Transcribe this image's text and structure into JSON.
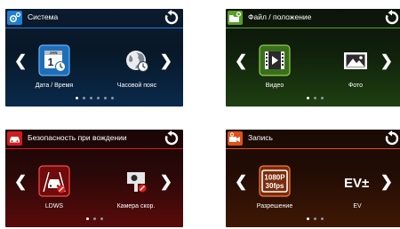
{
  "panels": {
    "system": {
      "title": "Система",
      "icon": "gear-icon",
      "accent": "#1e7fd4",
      "options": [
        {
          "label": "Дата / Время",
          "icon": "calendar-clock-icon",
          "selected": true
        },
        {
          "label": "Часовой пояс",
          "icon": "globe-clock-icon",
          "selected": false
        }
      ],
      "page_count": 6,
      "current_page": 1
    },
    "file": {
      "title": "Файл / положение",
      "icon": "folder-gear-icon",
      "accent": "#5aa028",
      "options": [
        {
          "label": "Видео",
          "icon": "film-icon",
          "selected": true
        },
        {
          "label": "Фото",
          "icon": "photo-icon",
          "selected": false
        }
      ],
      "page_count": 3,
      "current_page": 1
    },
    "safety": {
      "title": "Безопасность при вождении",
      "icon": "car-icon",
      "accent": "#d21c1c",
      "options": [
        {
          "label": "LDWS",
          "icon": "ldws-car-icon",
          "selected": true
        },
        {
          "label": "Камера скор.",
          "icon": "speed-camera-icon",
          "selected": false
        }
      ],
      "page_count": 3,
      "current_page": 1
    },
    "record": {
      "title": "Запись",
      "icon": "camcorder-gear-icon",
      "accent": "#e0501a",
      "options": [
        {
          "label": "Разрешение",
          "icon": "resolution-icon",
          "selected": true,
          "line1": "1080P",
          "line2": "30fps"
        },
        {
          "label": "EV",
          "icon": "ev-icon",
          "selected": false,
          "text": "EV±"
        }
      ],
      "page_count": 3,
      "current_page": 1
    }
  }
}
